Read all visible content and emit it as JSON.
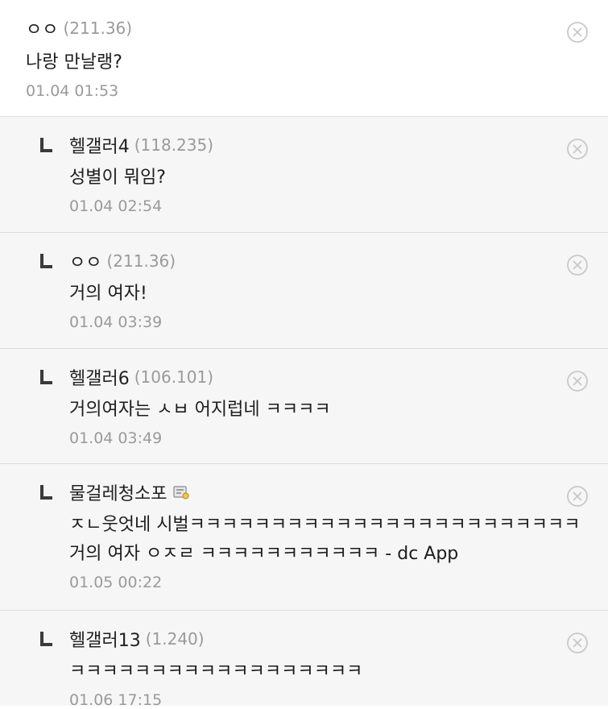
{
  "comments": [
    {
      "nick": "ㅇㅇ",
      "ip": "(211.36)",
      "lines": [
        "나랑 만날랭?"
      ],
      "time": "01.04 01:53"
    },
    {
      "nick": "헬갤러4",
      "ip": "(118.235)",
      "lines": [
        "성별이 뭐임?"
      ],
      "time": "01.04 02:54"
    },
    {
      "nick": "ㅇㅇ",
      "ip": "(211.36)",
      "lines": [
        "거의 여자!"
      ],
      "time": "01.04 03:39"
    },
    {
      "nick": "헬갤러6",
      "ip": "(106.101)",
      "lines": [
        "거의여자는 ㅅㅂ 어지럽네 ㅋㅋㅋㅋ"
      ],
      "time": "01.04 03:49"
    },
    {
      "nick": "물걸레청소포",
      "ip": "",
      "lines": [
        "ㅈㄴ웃엇네 시벌ㅋㅋㅋㅋㅋㅋㅋㅋㅋㅋㅋㅋㅋㅋㅋㅋㅋㅋㅋㅋㅋㅋㅋㅋ",
        "거의 여자 ㅇㅈㄹ ㅋㅋㅋㅋㅋㅋㅋㅋㅋㅋㅋ - dc App"
      ],
      "time": "01.05 00:22"
    },
    {
      "nick": "헬갤러13",
      "ip": "(1.240)",
      "lines": [
        "ㅋㅋㅋㅋㅋㅋㅋㅋㅋㅋㅋㅋㅋㅋㅋㅋㅋㅋ"
      ],
      "time": "01.06 17:15"
    }
  ],
  "icons": {
    "delete": "close-circle-icon",
    "reply": "reply-arrow-icon",
    "gallog": "gallog-user-icon"
  },
  "colors": {
    "reply_bg": "#f6f6f7",
    "meta": "#9a9a9a",
    "divider": "#dcdcdc"
  }
}
